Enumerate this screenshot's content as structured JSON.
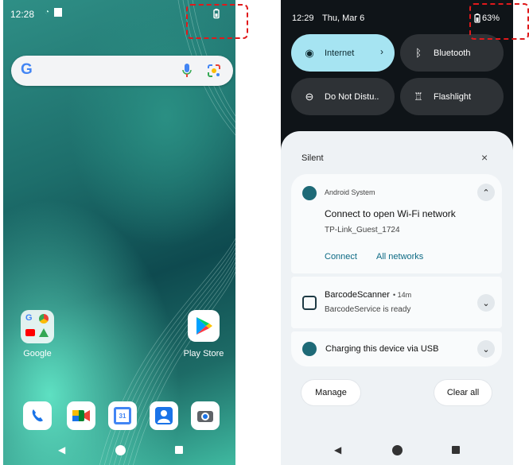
{
  "home": {
    "status_time": "12:28",
    "search_logo": "G",
    "folder_label": "Google",
    "playstore_label": "Play Store",
    "calendar_day": "31",
    "dock": [
      "phone-icon",
      "meet-icon",
      "calendar-icon",
      "contacts-icon",
      "camera-icon"
    ]
  },
  "shade": {
    "status_time": "12:29",
    "status_date": "Thu, Mar 6",
    "battery": "63%",
    "tiles": [
      {
        "label": "Internet",
        "icon": "wifi-icon",
        "active": true
      },
      {
        "label": "Bluetooth",
        "icon": "bluetooth-icon",
        "active": false
      },
      {
        "label": "Do Not Distu..",
        "icon": "dnd-icon",
        "active": false
      },
      {
        "label": "Flashlight",
        "icon": "flashlight-icon",
        "active": false
      }
    ],
    "section_title": "Silent",
    "notifications": {
      "wifi": {
        "app": "Android System",
        "title": "Connect to open Wi-Fi network",
        "subtitle": "TP-Link_Guest_1724",
        "action1": "Connect",
        "action2": "All networks"
      },
      "barcode": {
        "app": "BarcodeScanner",
        "time": " • 14m",
        "text": "BarcodeService is ready"
      },
      "usb": {
        "title": "Charging this device via USB"
      }
    },
    "manage_label": "Manage",
    "clear_label": "Clear all"
  },
  "colors": {
    "accent_tile": "#a6e4f2",
    "highlight": "#e0191b",
    "link": "#0d6a84"
  }
}
